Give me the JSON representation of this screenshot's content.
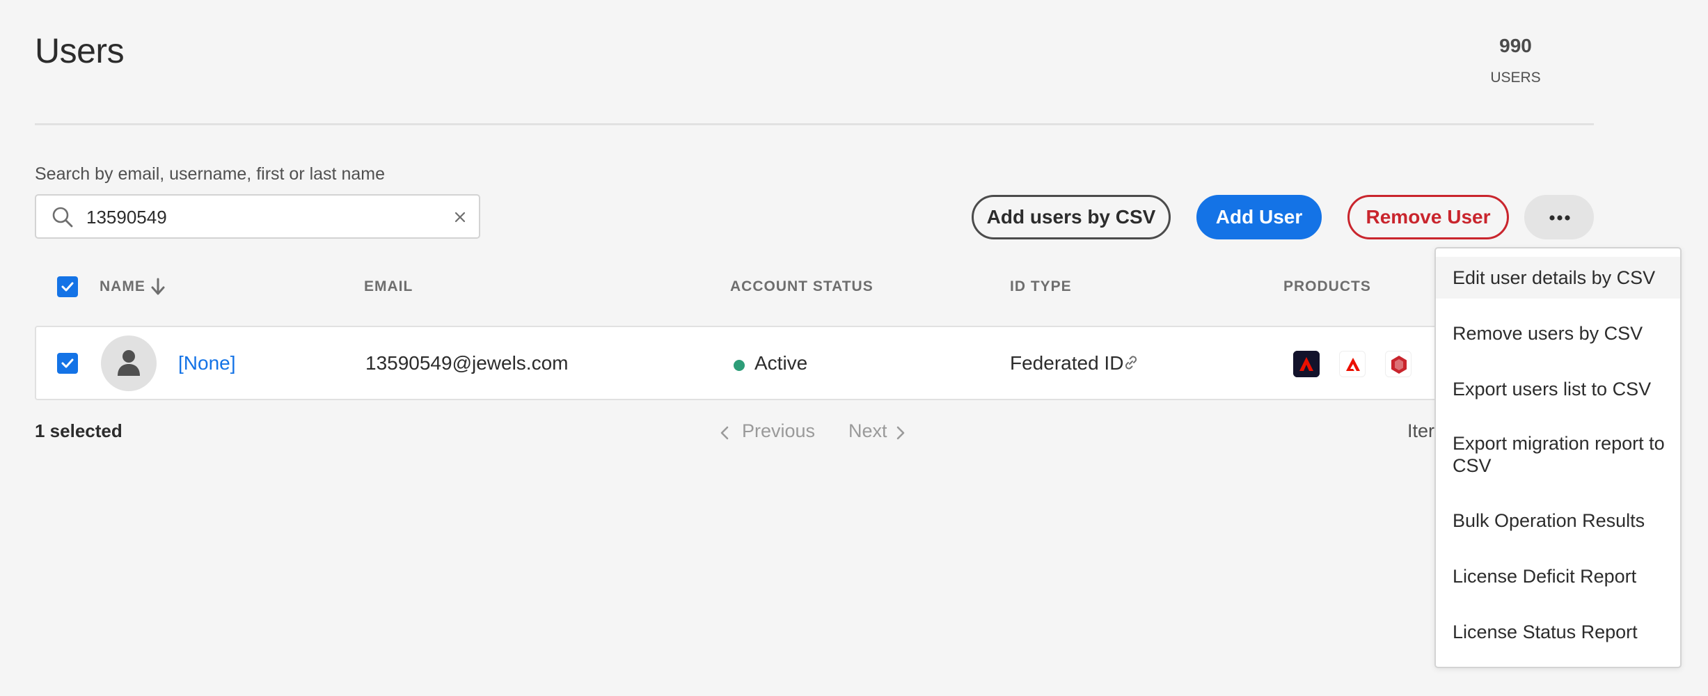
{
  "page": {
    "title": "Users"
  },
  "stats": {
    "count": "990",
    "label": "USERS"
  },
  "search": {
    "label": "Search by email, username, first or last name",
    "value": "13590549"
  },
  "actions": {
    "add_csv_label": "Add users by CSV",
    "add_user_label": "Add User",
    "remove_user_label": "Remove User"
  },
  "table": {
    "headers": {
      "name": "NAME",
      "email": "EMAIL",
      "account_status": "ACCOUNT STATUS",
      "id_type": "ID TYPE",
      "products": "PRODUCTS"
    },
    "rows": [
      {
        "name": "[None]",
        "email": "13590549@jewels.com",
        "status": "Active",
        "id_type": "Federated ID",
        "products": [
          "adobe-app-icon",
          "adobe-logo-icon",
          "acrobat-sign-icon"
        ]
      }
    ]
  },
  "footer": {
    "selected": "1 selected",
    "previous": "Previous",
    "next": "Next",
    "items_label": "Iter"
  },
  "menu": {
    "items": [
      {
        "label": "Edit user details by CSV"
      },
      {
        "label": "Remove users by CSV"
      },
      {
        "label": "Export users list to CSV"
      },
      {
        "label": "Export migration report to CSV"
      },
      {
        "label": "Bulk Operation Results"
      },
      {
        "label": "License Deficit Report"
      },
      {
        "label": "License Status Report"
      }
    ]
  },
  "colors": {
    "accent": "#1473e6",
    "negative": "#c9252d",
    "status_active": "#2d9d78",
    "adobe_red": "#eb1000"
  }
}
